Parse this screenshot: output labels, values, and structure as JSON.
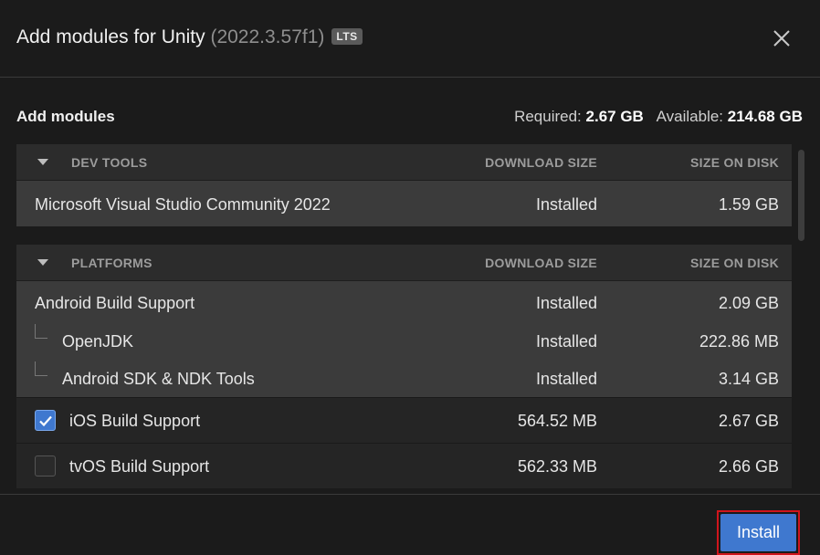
{
  "header": {
    "title_prefix": "Add modules for Unity",
    "version": "(2022.3.57f1)",
    "badge": "LTS",
    "close_icon": "close-icon"
  },
  "summary": {
    "heading": "Add modules",
    "required_label": "Required:",
    "required_value": "2.67 GB",
    "available_label": "Available:",
    "available_value": "214.68 GB"
  },
  "dev_tools": {
    "title": "DEV TOOLS",
    "col_download": "DOWNLOAD SIZE",
    "col_disk": "SIZE ON DISK",
    "rows": [
      {
        "name": "Microsoft Visual Studio Community 2022",
        "download": "Installed",
        "disk": "1.59 GB"
      }
    ]
  },
  "platforms": {
    "title": "PLATFORMS",
    "col_download": "DOWNLOAD SIZE",
    "col_disk": "SIZE ON DISK",
    "rows": [
      {
        "name": "Android Build Support",
        "download": "Installed",
        "disk": "2.09 GB"
      },
      {
        "name": "OpenJDK",
        "download": "Installed",
        "disk": "222.86 MB"
      },
      {
        "name": "Android SDK & NDK Tools",
        "download": "Installed",
        "disk": "3.14 GB"
      },
      {
        "name": "iOS Build Support",
        "download": "564.52 MB",
        "disk": "2.67 GB",
        "checked": true
      },
      {
        "name": "tvOS Build Support",
        "download": "562.33 MB",
        "disk": "2.66 GB",
        "checked": false
      }
    ]
  },
  "footer": {
    "install_label": "Install"
  },
  "colors": {
    "accent": "#3f78cf",
    "highlight": "#d0151c",
    "background": "#1b1b1b"
  }
}
